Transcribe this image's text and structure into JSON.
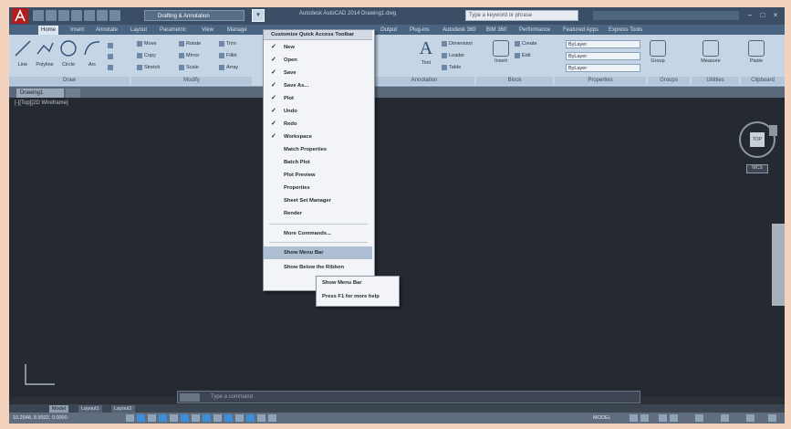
{
  "titlebar": {
    "workspace": "Drafting & Annotation",
    "title": "Autodesk AutoCAD 2014   Drawing1.dwg",
    "search_placeholder": "Type a keyword or phrase",
    "dropdown_icon": "chevron-down-icon"
  },
  "ribbon_tabs": [
    "Home",
    "Insert",
    "Annotate",
    "Layout",
    "Parametric",
    "View",
    "Manage",
    "Output",
    "Plug-ins",
    "Autodesk 360",
    "BIM 360",
    "Performance",
    "Featured Apps",
    "Express Tools"
  ],
  "ribbon": {
    "draw_tools": [
      "Line",
      "Polyline",
      "Circle",
      "Arc"
    ],
    "modify_tools": [
      "Move",
      "Rotate",
      "Trim",
      "Copy",
      "Mirror",
      "Fillet",
      "Stretch",
      "Scale",
      "Array"
    ],
    "annotation_tools": [
      "Text",
      "Dimension",
      "Leader",
      "Table"
    ],
    "block_tools": [
      "Insert",
      "Create",
      "Edit"
    ],
    "properties": [
      "ByLayer",
      "ByLayer",
      "ByLayer"
    ],
    "panel_labels": [
      "Draw",
      "Modify",
      "Annotation",
      "Block",
      "Properties",
      "Groups",
      "Utilities",
      "Clipboard"
    ],
    "right_tools": [
      "Group",
      "Measure",
      "Paste"
    ]
  },
  "file_tab": "Drawing1",
  "drawing": {
    "viewport_label": "[-][Top][2D Wireframe]",
    "viewcube_face": "TOP",
    "wcs_label": "WCS"
  },
  "qat_menu": {
    "header": "Customize Quick Access Toolbar",
    "checked_items": [
      "New",
      "Open",
      "Save",
      "Save As...",
      "Plot",
      "Undo",
      "Redo",
      "Workspace"
    ],
    "unchecked_items": [
      "Match Properties",
      "Batch Plot",
      "Plot Preview",
      "Properties",
      "Sheet Set Manager",
      "Render"
    ],
    "more_commands": "More Commands...",
    "show_menu_bar": "Show Menu Bar",
    "show_below": "Show Below the Ribbon",
    "check_icon": "check-icon"
  },
  "sub_menu": [
    "Show Menu Bar",
    "Press F1 for more help"
  ],
  "command_line": {
    "placeholder": "Type a command"
  },
  "layout_tabs": [
    "Model",
    "Layout1",
    "Layout2"
  ],
  "status": {
    "coords": "10.2648, 8.9932, 0.0000",
    "model": "MODEL"
  },
  "colors": {
    "background": "#f3d3bd",
    "drawing_area": "#252a31",
    "ribbon": "#c5d5e6",
    "menu_highlight": "#aebfd3"
  }
}
